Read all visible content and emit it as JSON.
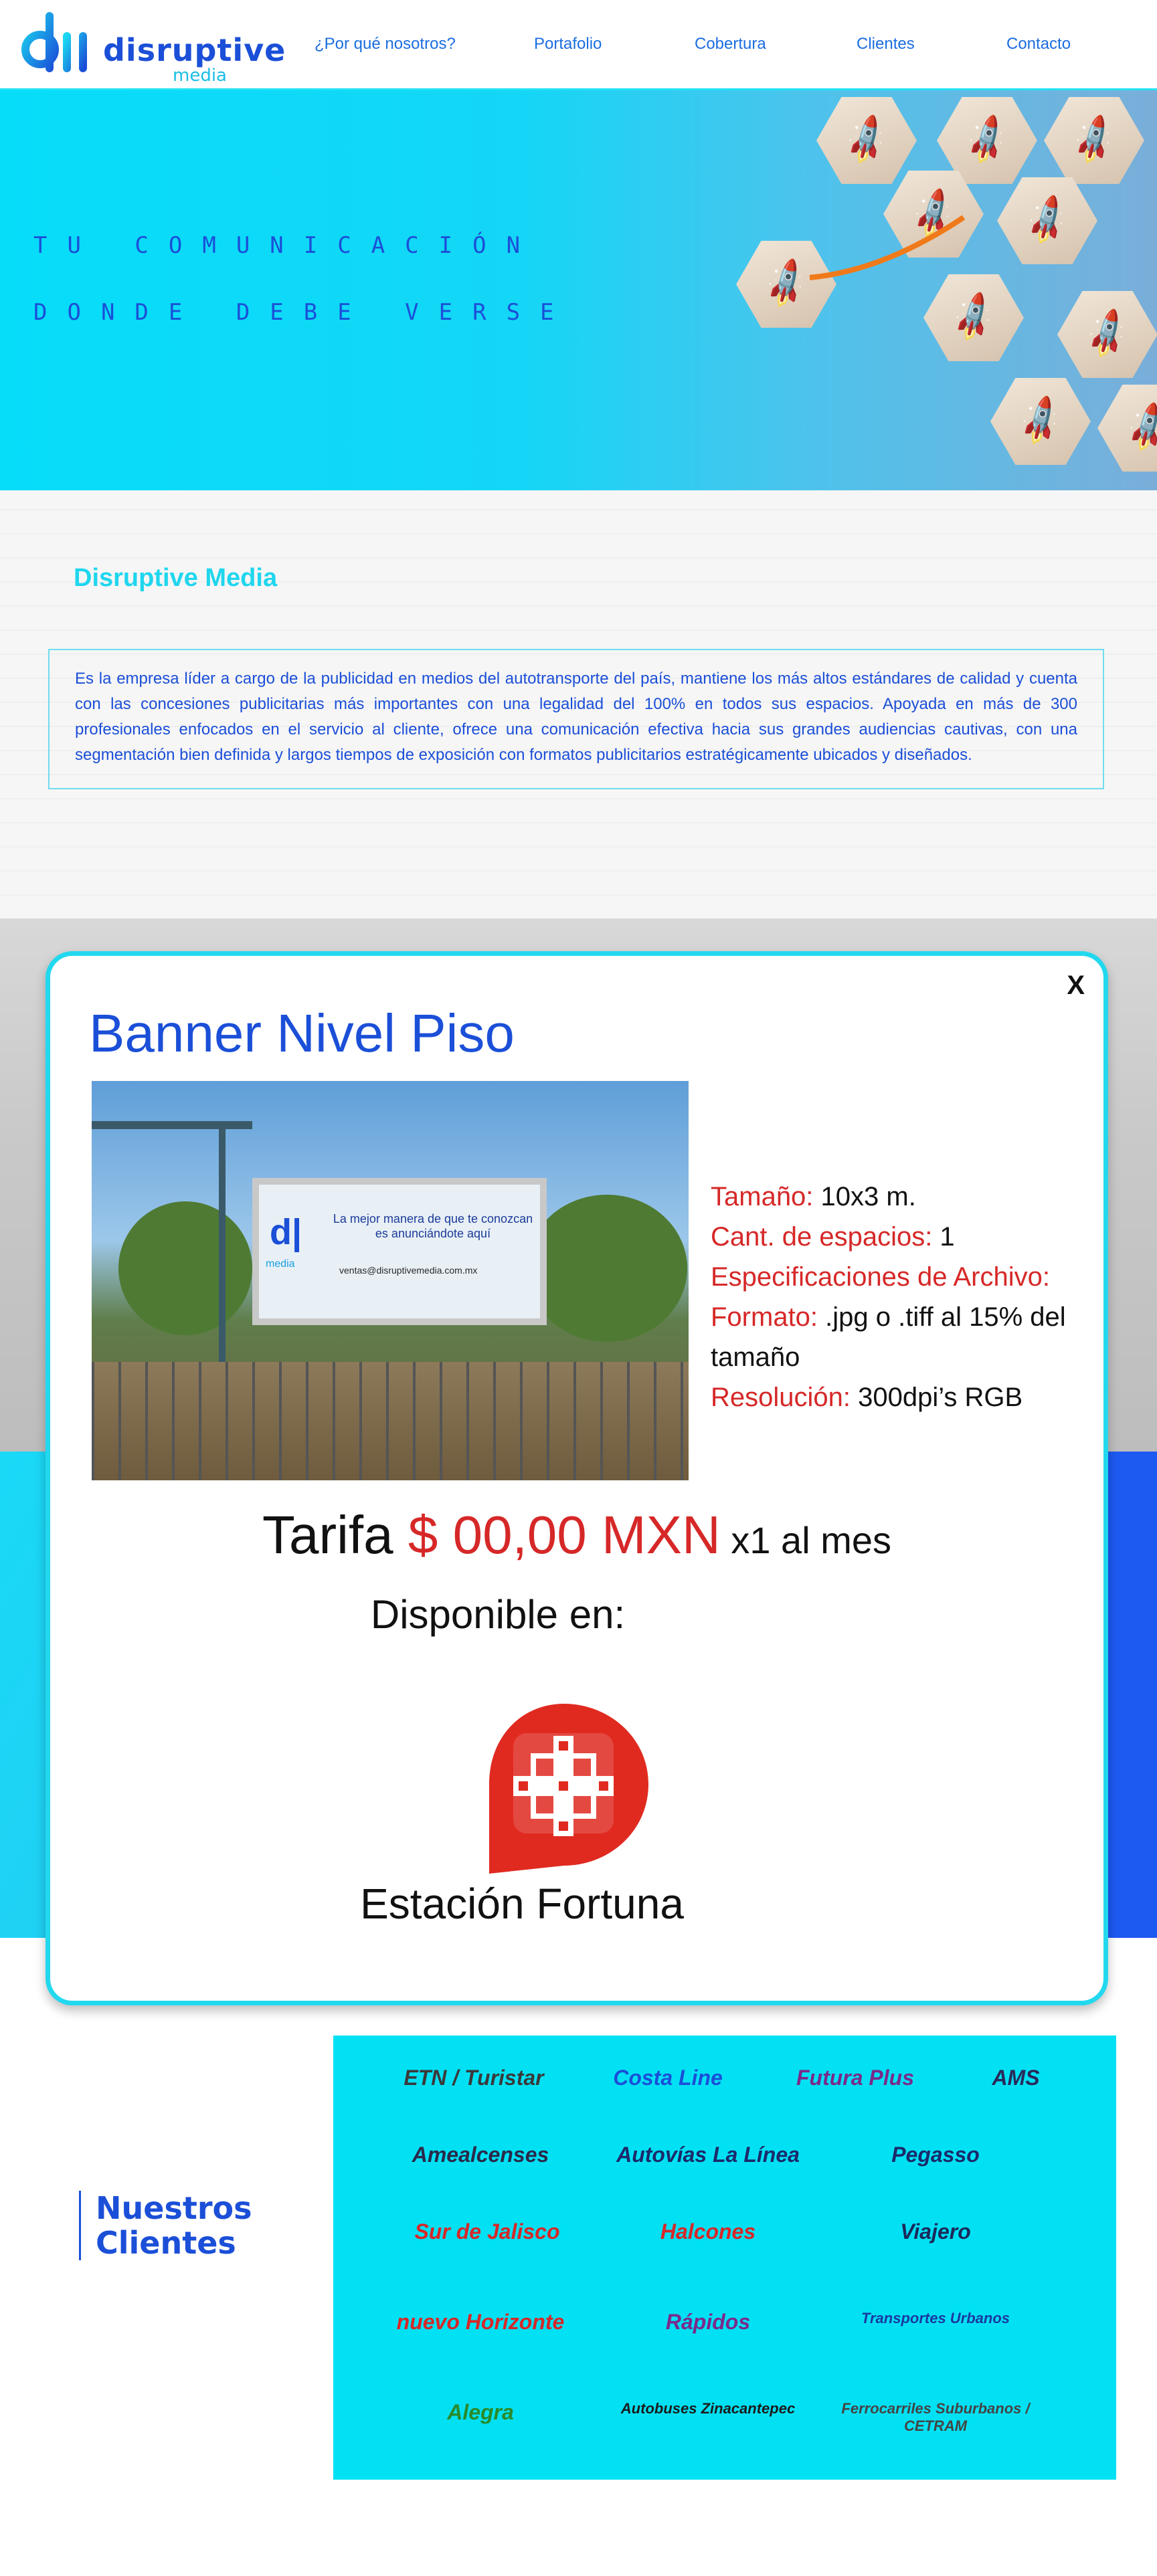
{
  "header": {
    "logo": {
      "name": "disruptive",
      "sub": "media"
    },
    "nav": [
      "¿Por qué nosotros?",
      "Portafolio",
      "Cobertura",
      "Clientes",
      "Contacto"
    ]
  },
  "hero": {
    "line1": "TU COMUNICACIÓN",
    "line2": "DONDE DEBE VERSE"
  },
  "about": {
    "title": "Disruptive Media",
    "body": "Es la empresa líder a cargo de la publicidad en medios del  autotransporte del país, mantiene los más altos estándares de calidad y cuenta con las concesiones publicitarias más importantes  con una legalidad del 100% en todos sus espacios. Apoyada en más de 300 profesionales enfocados en el servicio al cliente, ofrece una comunicación efectiva hacia sus grandes audiencias cautivas, con una segmentación bien definida y largos tiempos de exposición con formatos publicitarios estratégicamente ubicados y diseñados."
  },
  "modal": {
    "close": "X",
    "title": "Banner Nivel Piso",
    "billboard": {
      "text": "La mejor manera de que te conozcan es anunciándote aquí",
      "email": "ventas@disruptivemedia.com.mx",
      "logo_sub": "media"
    },
    "specs": {
      "size_label": "Tamaño:",
      "size_value": " 10x3 m.",
      "count_label": "Cant. de espacios:",
      "count_value": " 1",
      "file_label": "Especificaciones de Archivo:",
      "format_label": "Formato:",
      "format_value": " .jpg o .tiff al 15% del tamaño",
      "res_label": "Resolución:",
      "res_value": " 300dpi’s RGB"
    },
    "price": {
      "word": "Tarifa ",
      "value": "$ 00,00 MXN",
      "period": " x1 al mes"
    },
    "available": "Disponible en:",
    "station": "Estación Fortuna"
  },
  "clients": {
    "title_line1": "Nuestros",
    "title_line2": "Clientes",
    "logos": [
      "ETN / Turistar",
      "Costa Line",
      "Futura Plus",
      "AMS",
      "Amealcenses",
      "Autovías La Línea",
      "Pegasso",
      "Sur de Jalisco",
      "Halcones",
      "Viajero",
      "nuevo Horizonte",
      "Rápidos",
      "Transportes Urbanos",
      "Alegra",
      "Autobuses Zinacantepec",
      "Ferrocarriles Suburbanos / CETRAM"
    ]
  },
  "colors": {
    "accent": "#22d8ee",
    "brand_blue": "#1b4fd8",
    "price_red": "#d62828"
  }
}
